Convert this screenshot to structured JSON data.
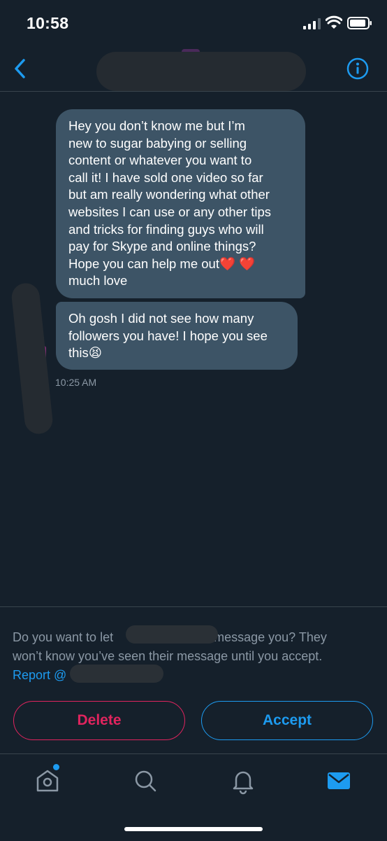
{
  "status_bar": {
    "time": "10:58"
  },
  "header": {
    "back_icon": "chevron-left-icon",
    "info_icon": "info-icon"
  },
  "messages": [
    {
      "text": "Hey you don’t know me but I’m\nnew to sugar babying or selling\ncontent or whatever you want to\ncall it! I have sold one video so far\nbut am really wondering what other\nwebsites I can use or any other tips\nand tricks for finding guys who will\npay for Skype and online things?\nHope you can help me out❤️ ❤️\nmuch love"
    },
    {
      "text": "Oh gosh I did not see how many\nfollowers you have! I hope you see\nthis😫"
    }
  ],
  "message_time": "10:25 AM",
  "request": {
    "line1_prefix": "Do you want to let",
    "line1_suffix": "message you? They",
    "line2": "won’t know you’ve seen their message until you accept.",
    "report_label": "Report @",
    "delete_label": "Delete",
    "accept_label": "Accept"
  },
  "tabs": [
    {
      "icon": "home-icon"
    },
    {
      "icon": "search-icon"
    },
    {
      "icon": "bell-icon"
    },
    {
      "icon": "mail-icon"
    }
  ],
  "colors": {
    "background": "#15202b",
    "bubble": "#3d5466",
    "accent": "#1d9bf0",
    "danger": "#e0245e",
    "muted_text": "#8b98a5"
  }
}
